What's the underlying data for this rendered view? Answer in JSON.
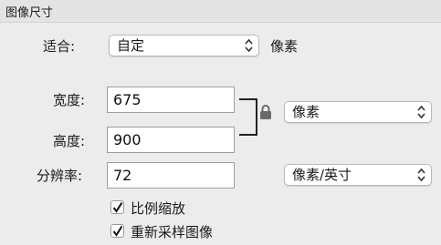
{
  "window": {
    "title": "图像尺寸"
  },
  "fit": {
    "label": "适合:",
    "value": "自定",
    "unit": "像素"
  },
  "width": {
    "label": "宽度:",
    "value": "675"
  },
  "height": {
    "label": "高度:",
    "value": "900"
  },
  "size_unit": {
    "value": "像素"
  },
  "resolution": {
    "label": "分辨率:",
    "value": "72",
    "unit_value": "像素/英寸"
  },
  "options": {
    "scale_proportionally": {
      "label": "比例缩放",
      "checked": true
    },
    "resample": {
      "label": "重新采样图像",
      "checked": true
    }
  },
  "icons": {
    "lock": "lock-icon",
    "chevron": "up-down-chevron-icon",
    "check": "checkmark-icon"
  }
}
